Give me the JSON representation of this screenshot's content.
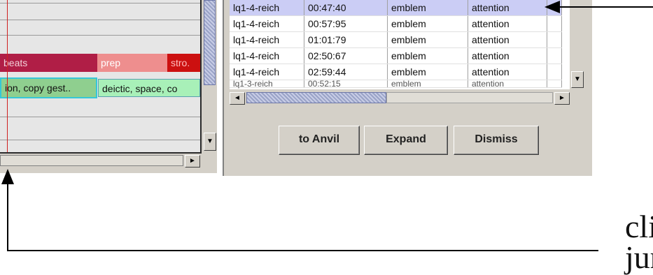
{
  "timeline": {
    "tracks": [
      {
        "segments": [
          {
            "label": "beats",
            "color": "#b01e46"
          },
          {
            "label": "prep",
            "color": "#ee8e8e"
          },
          {
            "label": "stro.",
            "color": "#cc1010"
          }
        ]
      },
      {
        "segments": [
          {
            "label": "ion, copy gest..",
            "color": "#8fcf8f"
          },
          {
            "label": "deictic, space, co",
            "color": "#a8f0b8"
          }
        ]
      }
    ],
    "scroll_right_glyph": "►",
    "scroll_down_glyph": "▼"
  },
  "results": {
    "rows": [
      {
        "file": "lq1-4-reich",
        "time": "00:47:40",
        "type": "emblem",
        "category": "attention",
        "selected": true
      },
      {
        "file": "lq1-4-reich",
        "time": "00:57:95",
        "type": "emblem",
        "category": "attention"
      },
      {
        "file": "lq1-4-reich",
        "time": "01:01:79",
        "type": "emblem",
        "category": "attention"
      },
      {
        "file": "lq1-4-reich",
        "time": "02:50:67",
        "type": "emblem",
        "category": "attention"
      },
      {
        "file": "lq1-4-reich",
        "time": "02:59:44",
        "type": "emblem",
        "category": "attention"
      },
      {
        "file": "lq1-3-reich",
        "time": "00:52:15",
        "type": "emblem",
        "category": "attention",
        "partial": true
      }
    ],
    "scroll_left_glyph": "◄",
    "scroll_right_glyph": "►",
    "scroll_down_glyph": "▼"
  },
  "buttons": {
    "to_anvil": "to Anvil",
    "expand": "Expand",
    "dismiss": "Dismiss"
  },
  "annotation": {
    "line1": "cli",
    "line2": "jun"
  }
}
